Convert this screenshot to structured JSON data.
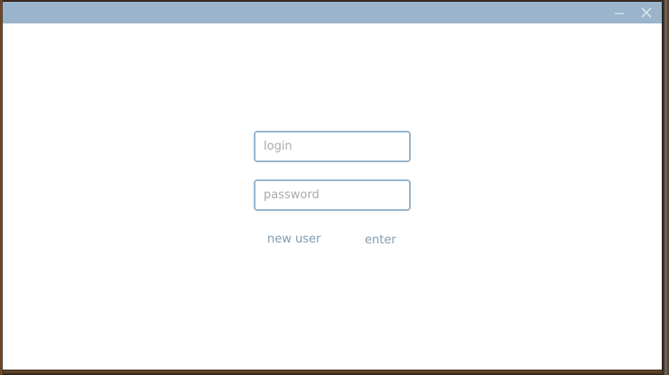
{
  "window": {
    "minimize_icon": "minimize-icon",
    "close_icon": "close-icon"
  },
  "form": {
    "login": {
      "placeholder": "login",
      "value": ""
    },
    "password": {
      "placeholder": "password",
      "value": ""
    },
    "new_user_label": "new user",
    "enter_label": "enter"
  },
  "colors": {
    "titlebar": "#9ab5cb",
    "accent": "#7f9db5",
    "field_border": "#9ab5cb"
  }
}
